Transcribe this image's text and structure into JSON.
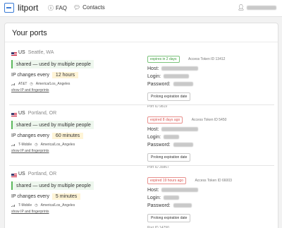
{
  "topbar": {
    "brand": "litport",
    "nav": [
      {
        "icon": "help-circle-icon",
        "label": "FAQ"
      },
      {
        "icon": "chat-bubbles-icon",
        "label": "Contacts"
      }
    ],
    "user_icon": "user-icon"
  },
  "page": {
    "title": "Your ports"
  },
  "ports": [
    {
      "country": "US",
      "city": "Seattle, WA",
      "sharing": "shared — used by multiple people",
      "ip_change_label": "IP changes every",
      "ip_change_value": "12 hours",
      "carrier": "AT&T",
      "timezone": "America/Los_Angeles",
      "show_ip": "show IP and fingerprints",
      "expiry": "expires in 2 days",
      "expiry_status": "ok",
      "token": "Access Token ID 13412",
      "host_label": "Host:",
      "login_label": "Login:",
      "password_label": "Password:",
      "prolong": "Prolong expiration date",
      "port_id": "Port ID 9819"
    },
    {
      "country": "US",
      "city": "Portland, OR",
      "sharing": "shared — used by multiple people",
      "ip_change_label": "IP changes every",
      "ip_change_value": "60 minutes",
      "carrier": "T-Mobile",
      "timezone": "America/Los_Angeles",
      "show_ip": "show IP and fingerprints",
      "expiry": "expired 8 days ago",
      "expiry_status": "expired",
      "token": "Access Token ID 5450",
      "host_label": "Host:",
      "login_label": "Login:",
      "password_label": "Password:",
      "prolong": "Prolong expiration date",
      "port_id": "Port ID 35867"
    },
    {
      "country": "US",
      "city": "Portland, OR",
      "sharing": "shared — used by multiple people",
      "ip_change_label": "IP changes every",
      "ip_change_value": "5 minutes",
      "carrier": "T-Mobile",
      "timezone": "America/Los_Angeles",
      "show_ip": "show IP and fingerprints",
      "expiry": "expired 19 hours ago",
      "expiry_status": "expired",
      "token": "Access Token ID 66003",
      "host_label": "Host:",
      "login_label": "Login:",
      "password_label": "Password:",
      "prolong": "Prolong expiration date",
      "port_id": "Port ID 14790"
    }
  ]
}
